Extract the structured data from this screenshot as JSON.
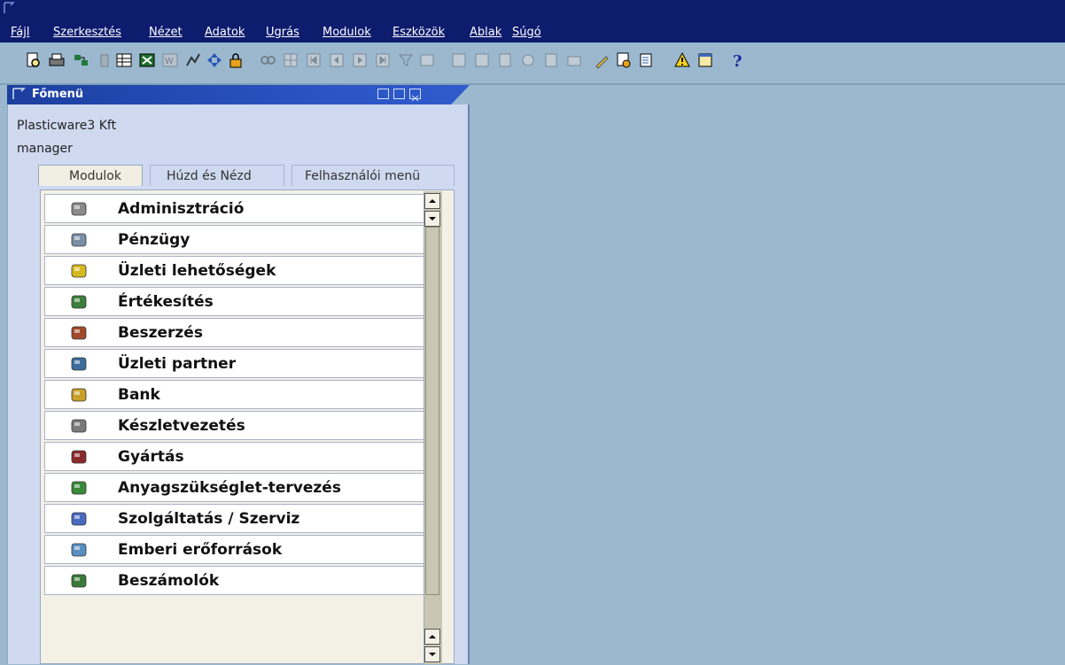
{
  "menubar": {
    "items": [
      "Fájl",
      "Szerkesztés",
      "Nézet",
      "Adatok",
      "Ugrás",
      "Modulok",
      "Eszközök",
      "Ablak",
      "Súgó"
    ]
  },
  "toolbar": {
    "icons": [
      "print-preview-icon",
      "print-icon",
      "send-icon",
      "lock-icon",
      "spreadsheet-icon",
      "excel-icon",
      "word-icon",
      "chart-icon",
      "navigate-icon",
      "padlock-icon",
      "find-icon",
      "grid-icon",
      "first-record-icon",
      "previous-record-icon",
      "next-record-icon",
      "last-record-icon",
      "filter-icon",
      "sort-icon",
      "duplicate-icon",
      "copy-icon",
      "documents-icon",
      "money-icon",
      "list-icon",
      "folder-icon",
      "edit-icon",
      "settings-icon",
      "report-icon",
      "alert-icon",
      "calendar-icon",
      "help-icon"
    ]
  },
  "window": {
    "title": "Főmenü",
    "company": "Plasticware3 Kft",
    "user": "manager"
  },
  "tabs": [
    "Modulok",
    "Húzd és Nézd",
    "Felhasználói menü"
  ],
  "modules": [
    {
      "label": "Adminisztráció",
      "icon": "administration-icon",
      "color": "#8a8a8a"
    },
    {
      "label": "Pénzügy",
      "icon": "finance-icon",
      "color": "#7b8fa7"
    },
    {
      "label": "Üzleti lehetőségek",
      "icon": "opportunities-icon",
      "color": "#d6b91e"
    },
    {
      "label": "Értékesítés",
      "icon": "sales-icon",
      "color": "#3c7f3c"
    },
    {
      "label": "Beszerzés",
      "icon": "purchasing-icon",
      "color": "#a04a2b"
    },
    {
      "label": "Üzleti partner",
      "icon": "business-partner-icon",
      "color": "#3d6d9a"
    },
    {
      "label": "Bank",
      "icon": "bank-icon",
      "color": "#c8a02a"
    },
    {
      "label": "Készletvezetés",
      "icon": "inventory-icon",
      "color": "#7a7a7a"
    },
    {
      "label": "Gyártás",
      "icon": "production-icon",
      "color": "#8a2a2a"
    },
    {
      "label": "Anyagszükséglet-tervezés",
      "icon": "mrp-icon",
      "color": "#3a8a3a"
    },
    {
      "label": "Szolgáltatás / Szerviz",
      "icon": "service-icon",
      "color": "#4a6abf"
    },
    {
      "label": "Emberi erőforrások",
      "icon": "human-resources-icon",
      "color": "#5a8fc0"
    },
    {
      "label": "Beszámolók",
      "icon": "reports-icon",
      "color": "#3a7a3a"
    }
  ]
}
